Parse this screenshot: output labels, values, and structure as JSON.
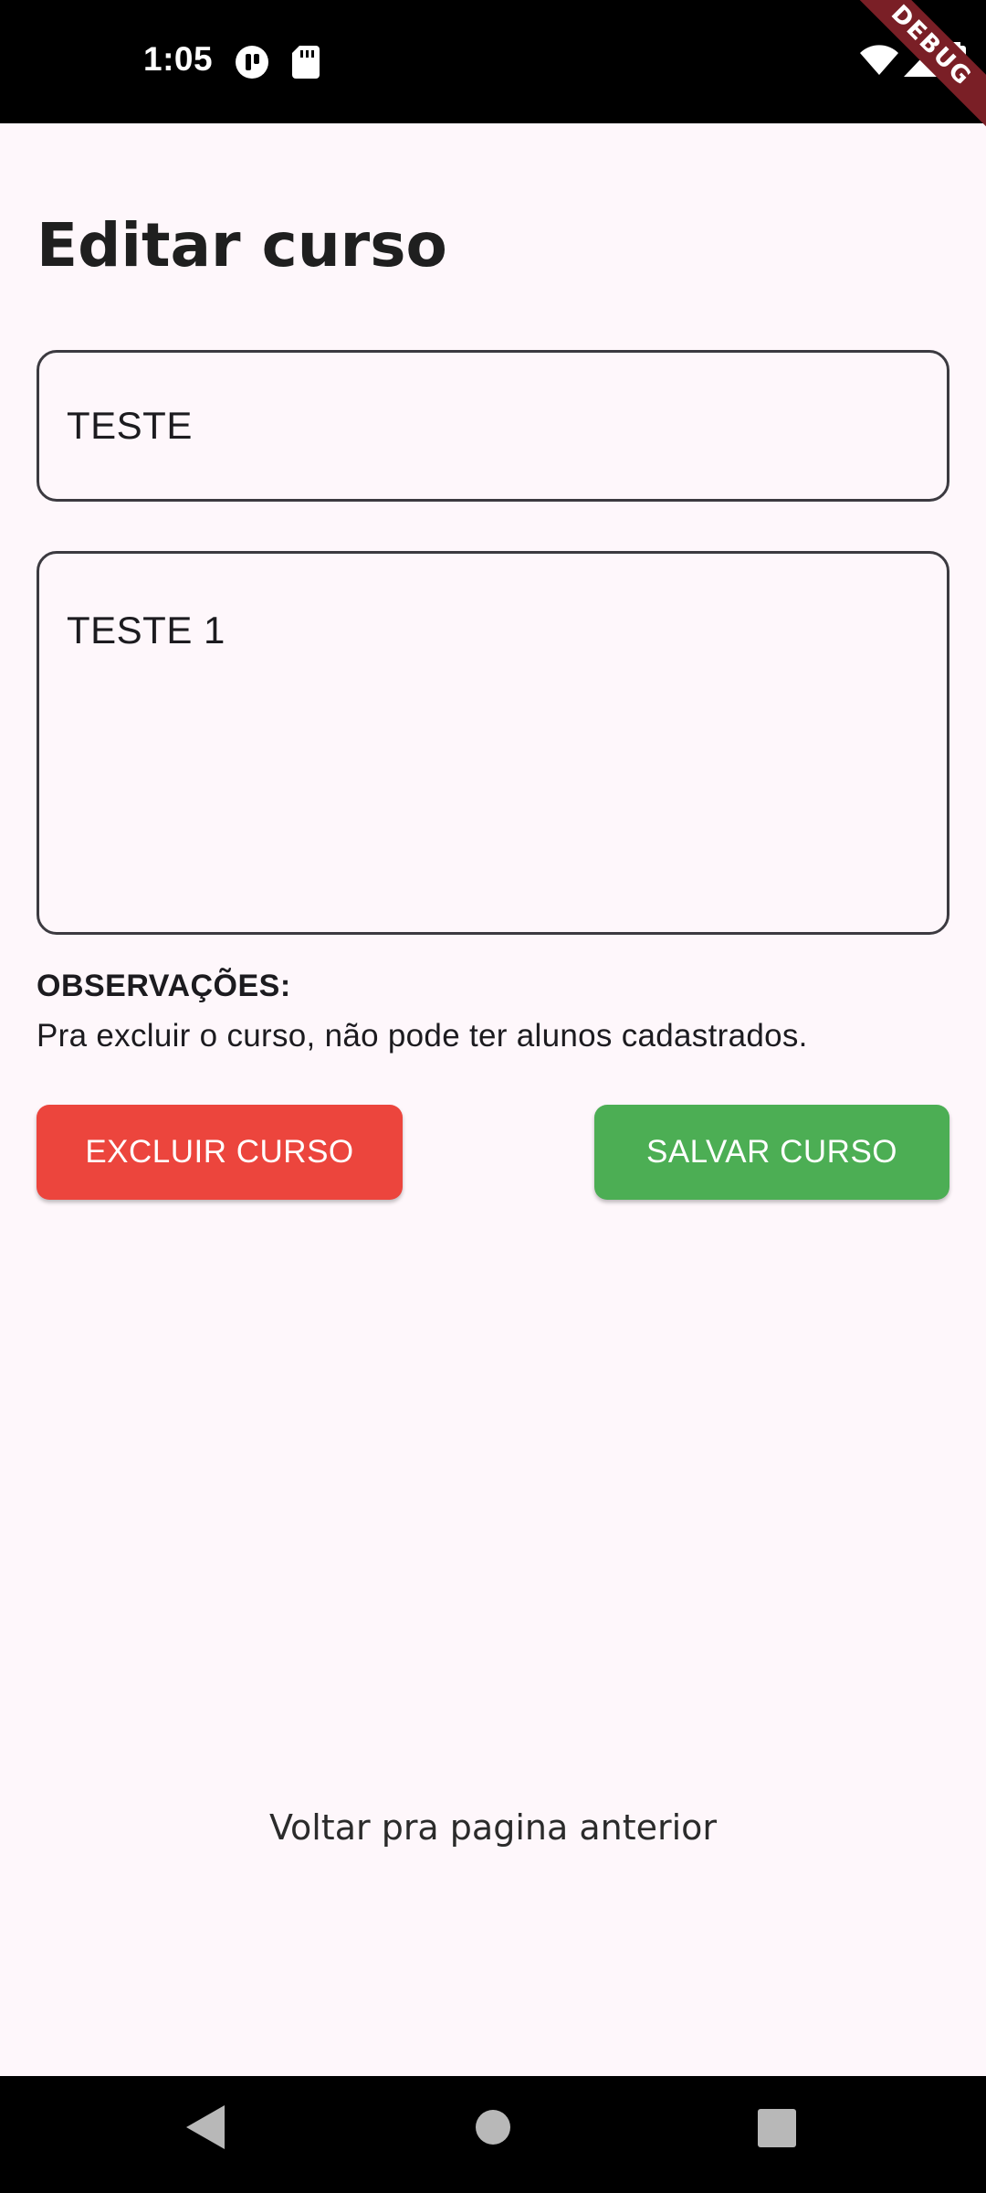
{
  "status_bar": {
    "time": "1:05",
    "icons": [
      "app-indicator-icon",
      "sd-card-icon",
      "wifi-icon",
      "signal-icon",
      "battery-icon"
    ],
    "debug_label": "DEBUG"
  },
  "page": {
    "title": "Editar curso"
  },
  "form": {
    "name_value": "TESTE",
    "description_value": "TESTE 1"
  },
  "notes": {
    "heading": "OBSERVAÇÕES:",
    "text": "Pra excluir o curso, não pode ter alunos cadastrados."
  },
  "actions": {
    "delete_label": "EXCLUIR CURSO",
    "save_label": "SALVAR CURSO",
    "delete_color": "#ec453d",
    "save_color": "#4cae54"
  },
  "footer": {
    "back_label": "Voltar pra pagina anterior"
  },
  "nav": {
    "icons": [
      "back-icon",
      "home-icon",
      "recents-icon"
    ]
  }
}
